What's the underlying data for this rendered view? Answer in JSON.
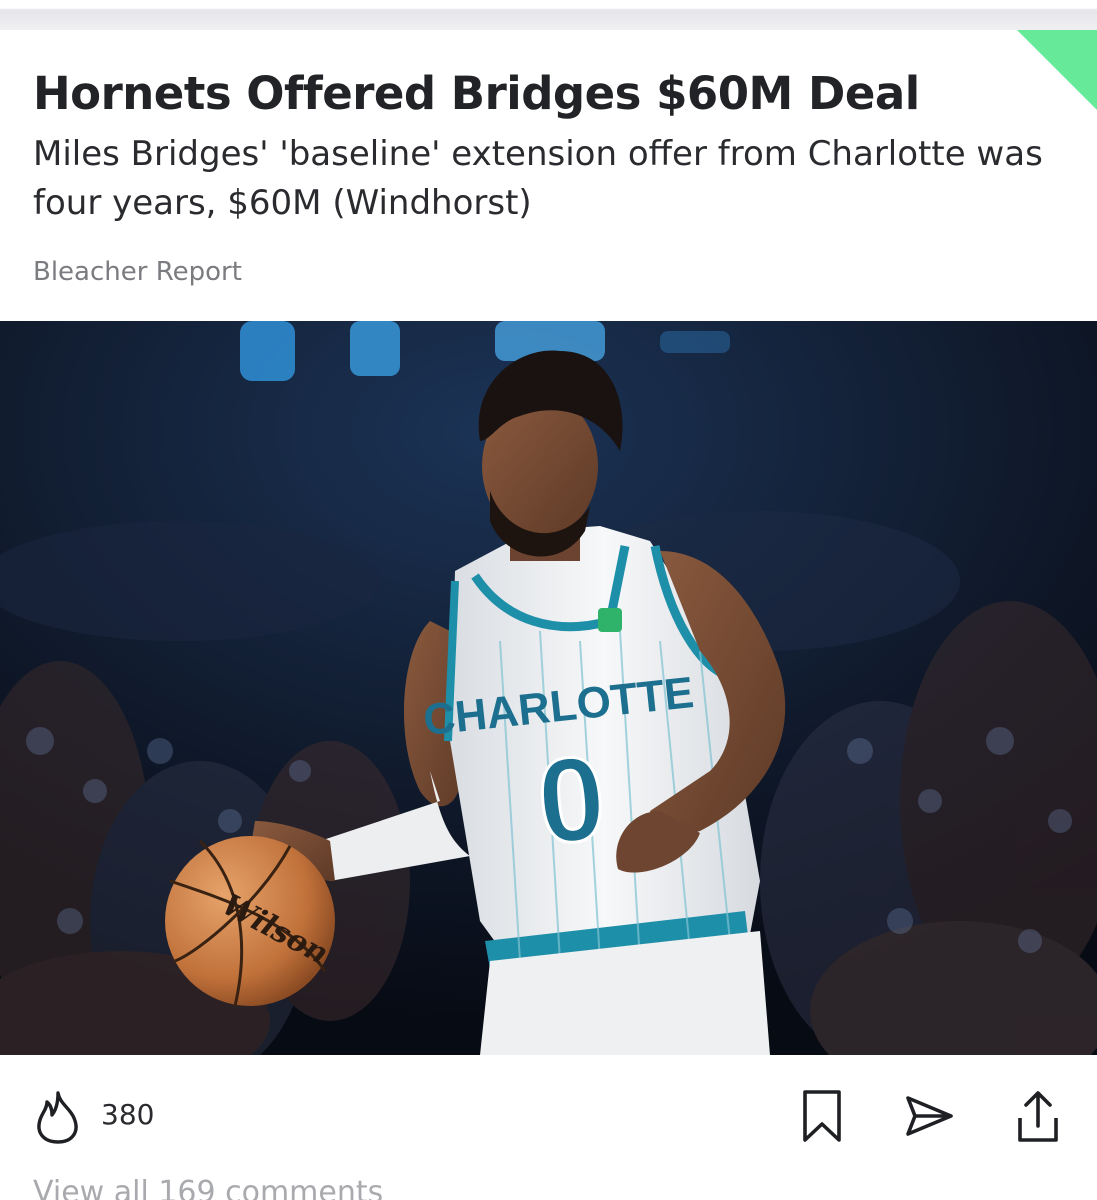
{
  "article": {
    "headline": "Hornets Offered Bridges $60M Deal",
    "subhead": "Miles Bridges' 'baseline' extension offer from Charlotte was four years, $60M (Windhorst)",
    "source": "Bleacher Report"
  },
  "photo": {
    "jersey_text": "CHARLOTTE",
    "jersey_number": "0",
    "ball_brand": "Wilson"
  },
  "actions": {
    "reaction_icon": "flame-icon",
    "reaction_count": "380",
    "bookmark_icon": "bookmark-icon",
    "send_icon": "send-icon",
    "share_icon": "share-icon"
  },
  "comments": {
    "link_text": "View all 169 comments"
  },
  "colors": {
    "accent": "#67e99a",
    "teal": "#1e8fa8"
  }
}
